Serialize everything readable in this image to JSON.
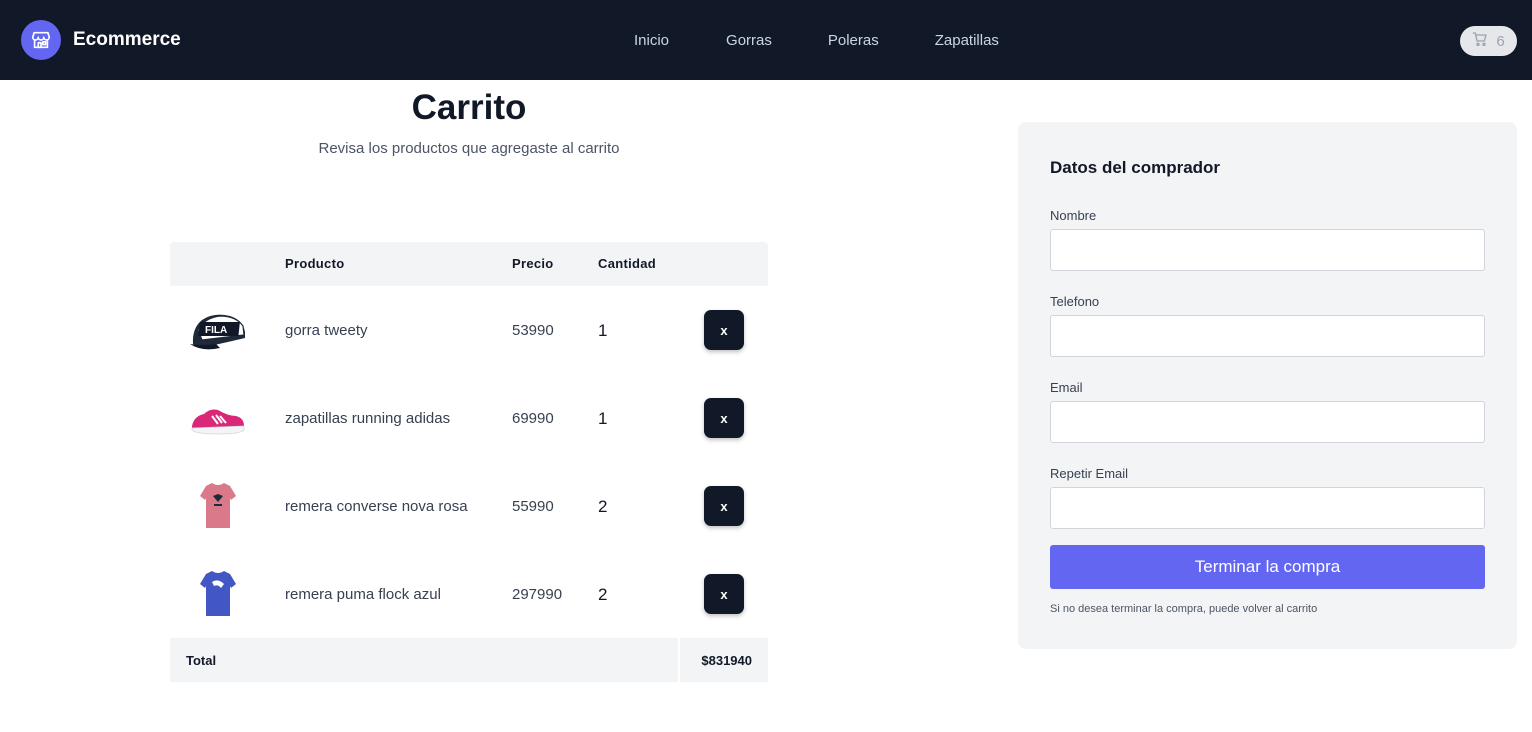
{
  "navbar": {
    "brand": "Ecommerce",
    "links": [
      "Inicio",
      "Gorras",
      "Poleras",
      "Zapatillas"
    ],
    "cart_count": "6",
    "bg_color": "#111827",
    "accent_color": "#6366f1"
  },
  "cart": {
    "title": "Carrito",
    "subtitle": "Revisa los productos que agregaste al carrito",
    "columns": [
      "Producto",
      "Precio",
      "Cantidad"
    ],
    "items": [
      {
        "name": "gorra tweety",
        "price": "53990",
        "qty": "1",
        "remove_label": "x",
        "image": "fila-cap-image"
      },
      {
        "name": "zapatillas running adidas",
        "price": "69990",
        "qty": "1",
        "remove_label": "x",
        "image": "pink-sneaker-image"
      },
      {
        "name": "remera converse nova rosa",
        "price": "55990",
        "qty": "2",
        "remove_label": "x",
        "image": "pink-tshirt-image"
      },
      {
        "name": "remera puma flock azul",
        "price": "297990",
        "qty": "2",
        "remove_label": "x",
        "image": "blue-tshirt-image"
      }
    ],
    "total_label": "Total",
    "total_value": "$831940"
  },
  "buyer": {
    "title": "Datos del comprador",
    "fields": [
      {
        "label": "Nombre",
        "value": "",
        "placeholder": ""
      },
      {
        "label": "Telefono",
        "value": "",
        "placeholder": ""
      },
      {
        "label": "Email",
        "value": "",
        "placeholder": ""
      },
      {
        "label": "Repetir Email",
        "value": "",
        "placeholder": ""
      }
    ],
    "submit_label": "Terminar la compra",
    "note": "Si no desea terminar la compra, puede volver al carrito"
  }
}
